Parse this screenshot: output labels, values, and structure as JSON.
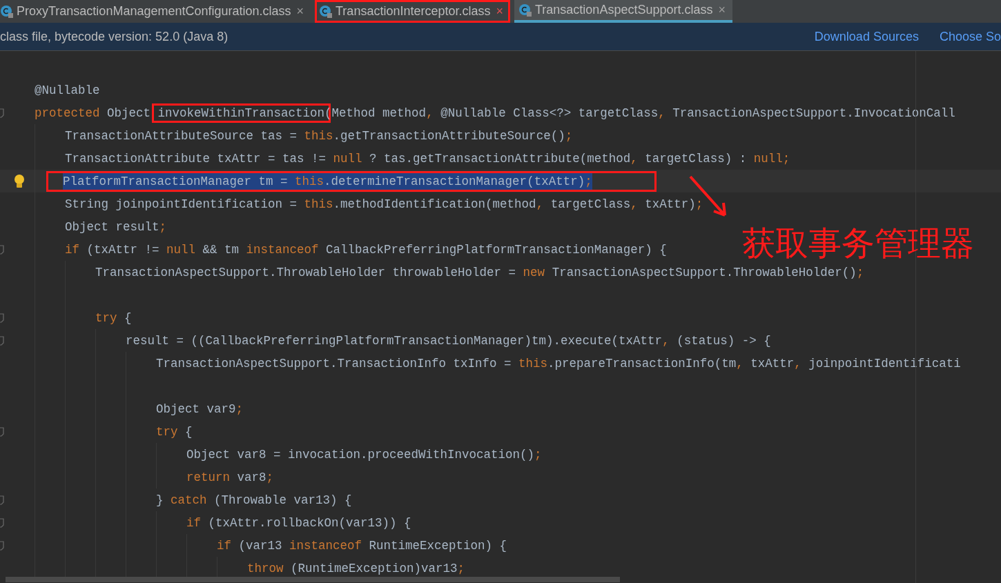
{
  "tabs": [
    {
      "label": "ProxyTransactionManagementConfiguration.class",
      "close": "×",
      "selected": false,
      "annotated": false
    },
    {
      "label": "TransactionInterceptor.class",
      "close": "×",
      "selected": false,
      "annotated": true
    },
    {
      "label": "TransactionAspectSupport.class",
      "close": "×",
      "selected": true,
      "annotated": false
    }
  ],
  "info_bar": {
    "message": "class file, bytecode version: 52.0 (Java 8)",
    "links": [
      "Download Sources",
      "Choose So"
    ]
  },
  "code_lines": [
    {
      "kind": "code",
      "fold": false,
      "selected": false,
      "boxed": false,
      "segments": [
        {
          "kind": "plain",
          "text": "@Nullable"
        }
      ]
    },
    {
      "kind": "code",
      "fold": true,
      "selected": false,
      "boxed": false,
      "segments": [
        {
          "kind": "kw",
          "text": "protected "
        },
        {
          "kind": "plain",
          "text": "Object "
        },
        {
          "kind": "boxed",
          "text": "invokeWithinTransaction"
        },
        {
          "kind": "plain",
          "text": "(Method method"
        },
        {
          "kind": "kw",
          "text": ", "
        },
        {
          "kind": "plain",
          "text": "@Nullable Class<?> targetClass"
        },
        {
          "kind": "kw",
          "text": ", "
        },
        {
          "kind": "plain",
          "text": "TransactionAspectSupport.InvocationCall"
        }
      ],
      "children": [
        {
          "kind": "code",
          "fold": false,
          "selected": false,
          "boxed": false,
          "segments": [
            {
              "kind": "plain",
              "text": "TransactionAttributeSource tas = "
            },
            {
              "kind": "kw",
              "text": "this"
            },
            {
              "kind": "plain",
              "text": ".getTransactionAttributeSource()"
            },
            {
              "kind": "kw",
              "text": ";"
            }
          ]
        },
        {
          "kind": "code",
          "fold": false,
          "selected": false,
          "boxed": false,
          "segments": [
            {
              "kind": "plain",
              "text": "TransactionAttribute txAttr = tas != "
            },
            {
              "kind": "kw",
              "text": "null"
            },
            {
              "kind": "plain",
              "text": " ? tas.getTransactionAttribute(method"
            },
            {
              "kind": "kw",
              "text": ", "
            },
            {
              "kind": "plain",
              "text": "targetClass) : "
            },
            {
              "kind": "kw",
              "text": "null;"
            }
          ]
        },
        {
          "kind": "code",
          "fold": false,
          "selected": true,
          "boxed": true,
          "segments": [
            {
              "kind": "plain",
              "text": "PlatformTransactionManager tm = "
            },
            {
              "kind": "kw",
              "text": "this"
            },
            {
              "kind": "plain",
              "text": ".determineTransactionManager(txAttr)"
            },
            {
              "kind": "kw",
              "text": ";"
            }
          ]
        },
        {
          "kind": "code",
          "fold": false,
          "selected": false,
          "boxed": false,
          "segments": [
            {
              "kind": "plain",
              "text": "String joinpointIdentification = "
            },
            {
              "kind": "kw",
              "text": "this"
            },
            {
              "kind": "plain",
              "text": ".methodIdentification(method"
            },
            {
              "kind": "kw",
              "text": ", "
            },
            {
              "kind": "plain",
              "text": "targetClass"
            },
            {
              "kind": "kw",
              "text": ", "
            },
            {
              "kind": "plain",
              "text": "txAttr)"
            },
            {
              "kind": "kw",
              "text": ";"
            }
          ]
        },
        {
          "kind": "code",
          "fold": false,
          "selected": false,
          "boxed": false,
          "segments": [
            {
              "kind": "plain",
              "text": "Object result"
            },
            {
              "kind": "kw",
              "text": ";"
            }
          ]
        },
        {
          "kind": "code",
          "fold": true,
          "selected": false,
          "boxed": false,
          "segments": [
            {
              "kind": "kw",
              "text": "if "
            },
            {
              "kind": "plain",
              "text": "(txAttr != "
            },
            {
              "kind": "kw",
              "text": "null "
            },
            {
              "kind": "plain",
              "text": "&& tm "
            },
            {
              "kind": "kw",
              "text": "instanceof "
            },
            {
              "kind": "plain",
              "text": "CallbackPreferringPlatformTransactionManager) {"
            }
          ],
          "children": [
            {
              "kind": "code",
              "fold": false,
              "selected": false,
              "boxed": false,
              "segments": [
                {
                  "kind": "plain",
                  "text": "TransactionAspectSupport.ThrowableHolder throwableHolder = "
                },
                {
                  "kind": "kw",
                  "text": "new "
                },
                {
                  "kind": "plain",
                  "text": "TransactionAspectSupport.ThrowableHolder()"
                },
                {
                  "kind": "kw",
                  "text": ";"
                }
              ]
            },
            {
              "kind": "blank"
            },
            {
              "kind": "code",
              "fold": true,
              "selected": false,
              "boxed": false,
              "segments": [
                {
                  "kind": "kw",
                  "text": "try "
                },
                {
                  "kind": "plain",
                  "text": "{"
                }
              ],
              "children": [
                {
                  "kind": "code",
                  "fold": true,
                  "selected": false,
                  "boxed": false,
                  "segments": [
                    {
                      "kind": "plain",
                      "text": "result = ((CallbackPreferringPlatformTransactionManager)tm).execute(txAttr"
                    },
                    {
                      "kind": "kw",
                      "text": ", "
                    },
                    {
                      "kind": "plain",
                      "text": "(status) -> {"
                    }
                  ],
                  "children": [
                    {
                      "kind": "code",
                      "fold": false,
                      "selected": false,
                      "boxed": false,
                      "segments": [
                        {
                          "kind": "plain",
                          "text": "TransactionAspectSupport.TransactionInfo txInfo = "
                        },
                        {
                          "kind": "kw",
                          "text": "this"
                        },
                        {
                          "kind": "plain",
                          "text": ".prepareTransactionInfo(tm"
                        },
                        {
                          "kind": "kw",
                          "text": ", "
                        },
                        {
                          "kind": "plain",
                          "text": "txAttr"
                        },
                        {
                          "kind": "kw",
                          "text": ", "
                        },
                        {
                          "kind": "plain",
                          "text": "joinpointIdentificati"
                        }
                      ]
                    },
                    {
                      "kind": "blank"
                    },
                    {
                      "kind": "code",
                      "fold": false,
                      "selected": false,
                      "boxed": false,
                      "segments": [
                        {
                          "kind": "plain",
                          "text": "Object var9"
                        },
                        {
                          "kind": "kw",
                          "text": ";"
                        }
                      ]
                    },
                    {
                      "kind": "code",
                      "fold": true,
                      "selected": false,
                      "boxed": false,
                      "segments": [
                        {
                          "kind": "kw",
                          "text": "try "
                        },
                        {
                          "kind": "plain",
                          "text": "{"
                        }
                      ],
                      "children": [
                        {
                          "kind": "code",
                          "fold": false,
                          "selected": false,
                          "boxed": false,
                          "segments": [
                            {
                              "kind": "plain",
                              "text": "Object var8 = invocation.proceedWithInvocation()"
                            },
                            {
                              "kind": "kw",
                              "text": ";"
                            }
                          ]
                        },
                        {
                          "kind": "code",
                          "fold": false,
                          "selected": false,
                          "boxed": false,
                          "segments": [
                            {
                              "kind": "kw",
                              "text": "return "
                            },
                            {
                              "kind": "plain",
                              "text": "var8"
                            },
                            {
                              "kind": "kw",
                              "text": ";"
                            }
                          ]
                        }
                      ]
                    },
                    {
                      "kind": "code",
                      "fold": true,
                      "selected": false,
                      "boxed": false,
                      "segments": [
                        {
                          "kind": "plain",
                          "text": "} "
                        },
                        {
                          "kind": "kw",
                          "text": "catch "
                        },
                        {
                          "kind": "plain",
                          "text": "(Throwable var13) {"
                        }
                      ],
                      "children": [
                        {
                          "kind": "code",
                          "fold": true,
                          "selected": false,
                          "boxed": false,
                          "segments": [
                            {
                              "kind": "kw",
                              "text": "if "
                            },
                            {
                              "kind": "plain",
                              "text": "(txAttr.rollbackOn(var13)) {"
                            }
                          ],
                          "children": [
                            {
                              "kind": "code",
                              "fold": true,
                              "selected": false,
                              "boxed": false,
                              "segments": [
                                {
                                  "kind": "kw",
                                  "text": "if "
                                },
                                {
                                  "kind": "plain",
                                  "text": "(var13 "
                                },
                                {
                                  "kind": "kw",
                                  "text": "instanceof "
                                },
                                {
                                  "kind": "plain",
                                  "text": "RuntimeException) {"
                                }
                              ],
                              "children": [
                                {
                                  "kind": "code",
                                  "fold": false,
                                  "selected": false,
                                  "boxed": false,
                                  "segments": [
                                    {
                                      "kind": "kw",
                                      "text": "throw "
                                    },
                                    {
                                      "kind": "plain",
                                      "text": "(RuntimeException)var13"
                                    },
                                    {
                                      "kind": "kw",
                                      "text": ";"
                                    }
                                  ]
                                }
                              ]
                            }
                          ]
                        }
                      ]
                    }
                  ]
                }
              ]
            }
          ]
        }
      ]
    }
  ],
  "annotation": {
    "text": "获取事务管理器"
  }
}
